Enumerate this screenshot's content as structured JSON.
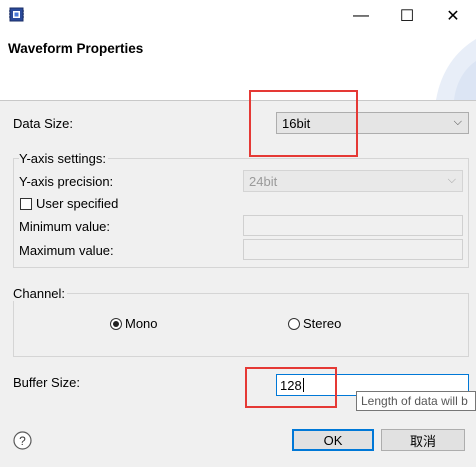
{
  "window": {
    "minimize_glyph": "—",
    "maximize_glyph": "☐",
    "close_glyph": "✕"
  },
  "header": {
    "title": "Waveform Properties"
  },
  "data_size": {
    "label": "Data Size:",
    "value": "16bit"
  },
  "y_axis": {
    "group_label": "Y-axis settings:",
    "precision_label": "Y-axis precision:",
    "precision_value": "24bit",
    "user_specified_label": "User specified",
    "user_specified_checked": false,
    "min_label": "Minimum value:",
    "max_label": "Maximum value:"
  },
  "channel": {
    "group_label": "Channel:",
    "mono_label": "Mono",
    "stereo_label": "Stereo",
    "selected": "Mono"
  },
  "buffer_size": {
    "label": "Buffer Size:",
    "value": "128",
    "tooltip": "Length of data will b"
  },
  "buttons": {
    "ok": "OK",
    "cancel": "取消"
  },
  "colors": {
    "accent": "#0078d7",
    "highlight": "#e53935",
    "background": "#f0f0f0"
  }
}
